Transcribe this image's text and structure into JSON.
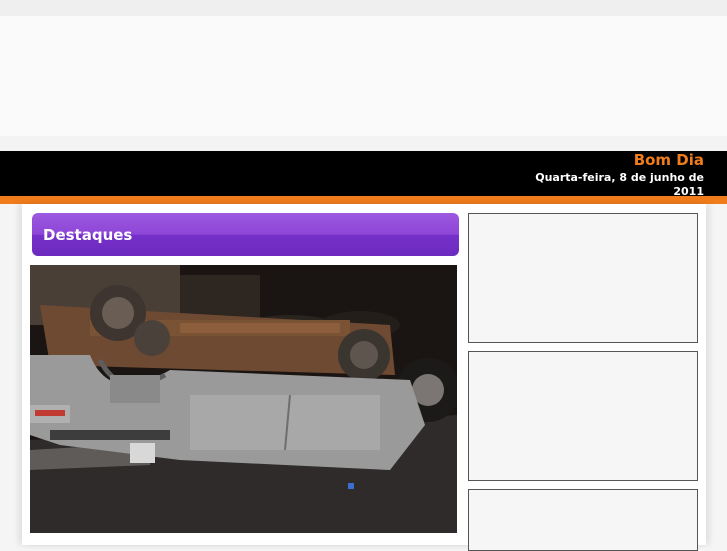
{
  "header": {
    "greeting": "Bom Dia",
    "date": "Quarta-feira, 8 de junho de 2011"
  },
  "main": {
    "section_title": "Destaques",
    "featured_photo": "overturned-pickup-photo"
  },
  "colors": {
    "accent_orange": "#f07c1c",
    "header_black": "#000000",
    "section_purple": "#8d45d6"
  }
}
